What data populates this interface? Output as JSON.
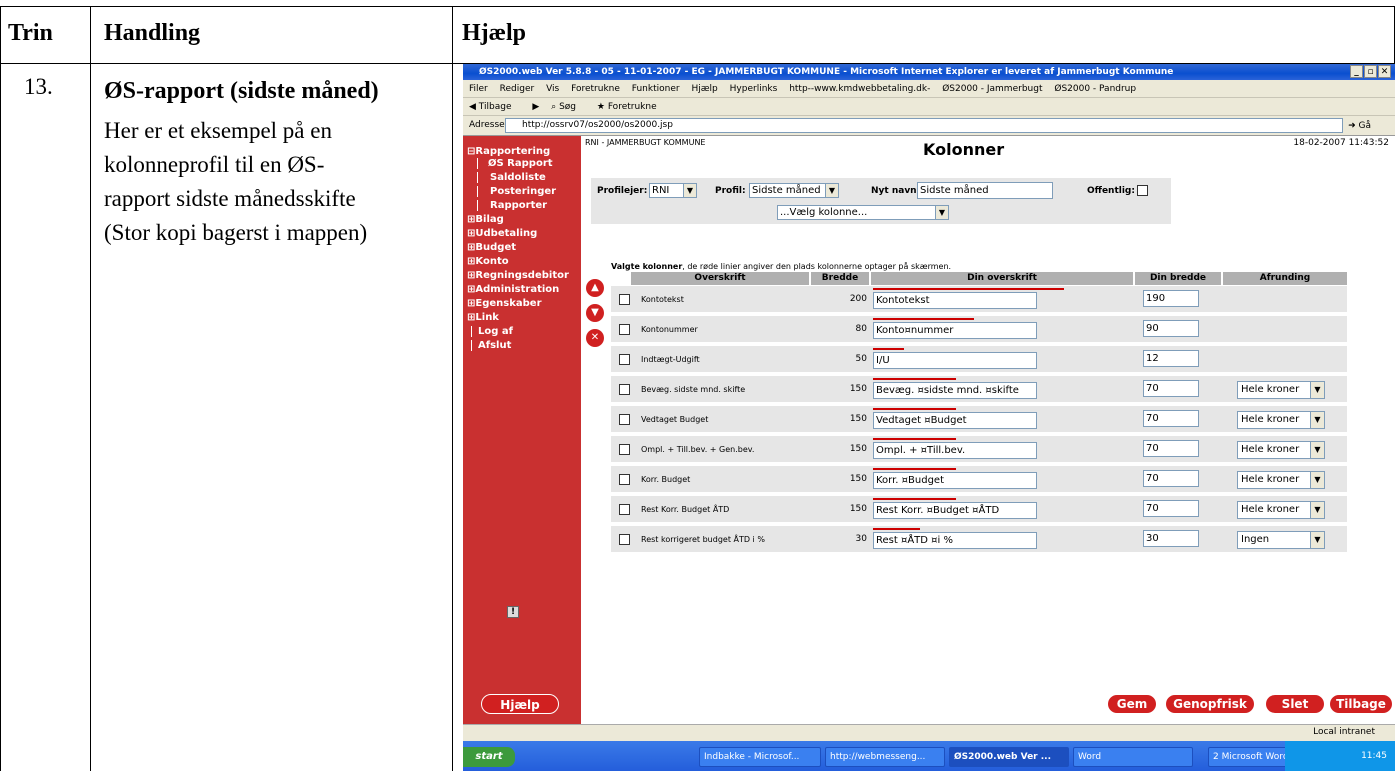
{
  "table": {
    "headers": {
      "step": "Trin",
      "action": "Handling",
      "help": "Hjælp"
    },
    "row": {
      "step": "13.",
      "title": "ØS-rapport (sidste måned)",
      "text_lines": [
        "Her er et eksempel på en",
        "kolonneprofil til en ØS-",
        "rapport sidste månedsskifte",
        "(Stor kopi bagerst i mappen)"
      ]
    }
  },
  "browser": {
    "title": "ØS2000.web Ver 5.8.8 - 05 - 11-01-2007 - EG - JAMMERBUGT KOMMUNE - Microsoft Internet Explorer er leveret af Jammerbugt Kommune",
    "menu": [
      "Filer",
      "Rediger",
      "Vis",
      "Foretrukne",
      "Funktioner",
      "Hjælp",
      "Hyperlinks",
      "http--www.kmdwebbetaling.dk-",
      "ØS2000 - Jammerbugt",
      "ØS2000 - Pandrup"
    ],
    "toolbar": [
      "Tilbage",
      "Søg",
      "Foretrukne"
    ],
    "address_label": "Adresse",
    "address": "http://ossrv07/os2000/os2000.jsp",
    "go": "Gå",
    "status_right": "Local intranet"
  },
  "sidebar": {
    "items": [
      "Rapportering",
      "ØS Rapport",
      "Saldoliste",
      "Posteringer",
      "Rapporter",
      "Bilag",
      "Udbetaling",
      "Budget",
      "Konto",
      "Regningsdebitor",
      "Administration",
      "Egenskaber",
      "Link",
      "Log af",
      "Afslut"
    ],
    "help_button": "Hjælp"
  },
  "page": {
    "header_left": "RNI  -  JAMMERBUGT KOMMUNE",
    "title": "Kolonner",
    "datetime": "18-02-2007 11:43:52",
    "profilejer_label": "Profilejer:",
    "profilejer": "RNI",
    "profil_label": "Profil:",
    "profil": "Sidste måned",
    "nyt_navn_label": "Nyt navn:",
    "nyt_navn": "Sidste måned",
    "offentlig_label": "Offentlig:",
    "vaelg": "...Vælg kolonne...",
    "info_bold": "Valgte kolonner",
    "info_rest": ", de røde linier angiver den plads kolonnerne optager på skærmen.",
    "columns": [
      "Overskrift",
      "Bredde",
      "Din overskrift",
      "Din bredde",
      "Afrunding"
    ],
    "rows": [
      {
        "label": "Kontotekst",
        "width": "200",
        "heading": "Kontotekst",
        "din_bredde": "190",
        "rounding": ""
      },
      {
        "label": "Kontonummer",
        "width": "80",
        "heading": "Konto¤nummer",
        "din_bredde": "90",
        "rounding": ""
      },
      {
        "label": "Indtægt-Udgift",
        "width": "50",
        "heading": "I/U",
        "din_bredde": "12",
        "rounding": ""
      },
      {
        "label": "Bevæg. sidste mnd. skifte",
        "width": "150",
        "heading": "Bevæg. ¤sidste mnd. ¤skifte",
        "din_bredde": "70",
        "rounding": "Hele kroner"
      },
      {
        "label": "Vedtaget Budget",
        "width": "150",
        "heading": "Vedtaget ¤Budget",
        "din_bredde": "70",
        "rounding": "Hele kroner"
      },
      {
        "label": "Ompl. + Till.bev. + Gen.bev.",
        "width": "150",
        "heading": "Ompl. + ¤Till.bev.",
        "din_bredde": "70",
        "rounding": "Hele kroner"
      },
      {
        "label": "Korr. Budget",
        "width": "150",
        "heading": "Korr. ¤Budget",
        "din_bredde": "70",
        "rounding": "Hele kroner"
      },
      {
        "label": "Rest Korr. Budget ÅTD",
        "width": "150",
        "heading": "Rest Korr. ¤Budget ¤ÅTD",
        "din_bredde": "70",
        "rounding": "Hele kroner"
      },
      {
        "label": "Rest korrigeret budget ÅTD i %",
        "width": "30",
        "heading": "Rest ¤ÅTD ¤i %",
        "din_bredde": "30",
        "rounding": "Ingen"
      }
    ],
    "buttons": {
      "gem": "Gem",
      "genopfrisk": "Genopfrisk",
      "slet": "Slet",
      "tilbage": "Tilbage"
    }
  },
  "taskbar": {
    "start": "start",
    "tasks": [
      "Indbakke - Microsof...",
      "http://webmesseng...",
      "ØS2000.web Ver ...",
      "Word",
      "2 Microsoft Word"
    ],
    "clock": "11:45"
  }
}
